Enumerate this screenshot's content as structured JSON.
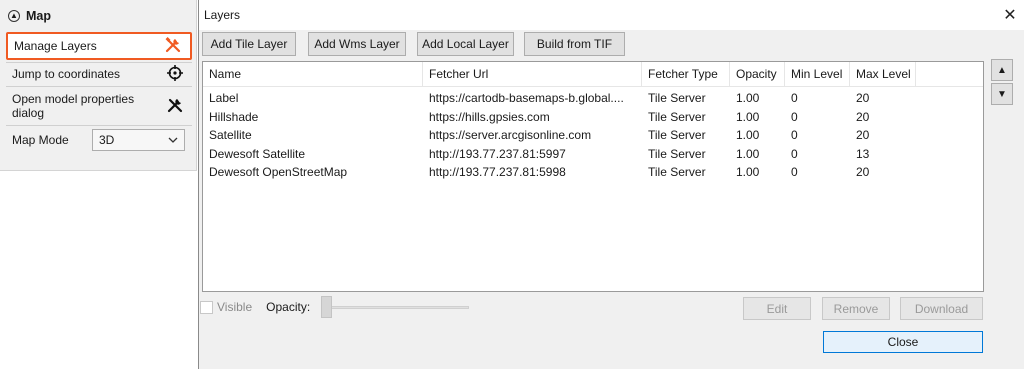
{
  "side": {
    "title": "Map",
    "items": [
      {
        "label": "Manage Layers",
        "icon": "tools-icon"
      },
      {
        "label": "Jump to coordinates",
        "icon": "crosshair-icon"
      },
      {
        "label": "Open model properties dialog",
        "icon": "tools-icon"
      }
    ],
    "map_mode_label": "Map Mode",
    "map_mode_value": "3D",
    "accent": "#f05a22"
  },
  "dialog": {
    "title": "Layers",
    "toolbar": [
      "Add Tile Layer",
      "Add Wms Layer",
      "Add Local Layer",
      "Build from TIF"
    ],
    "columns": [
      "Name",
      "Fetcher Url",
      "Fetcher Type",
      "Opacity",
      "Min Level",
      "Max Level"
    ],
    "rows": [
      [
        "Label",
        "https://cartodb-basemaps-b.global....",
        "Tile Server",
        "1.00",
        "0",
        "20"
      ],
      [
        "Hillshade",
        "https://hills.gpsies.com",
        "Tile Server",
        "1.00",
        "0",
        "20"
      ],
      [
        "Satellite",
        "https://server.arcgisonline.com",
        "Tile Server",
        "1.00",
        "0",
        "20"
      ],
      [
        "Dewesoft Satellite",
        "http://193.77.237.81:5997",
        "Tile Server",
        "1.00",
        "0",
        "13"
      ],
      [
        "Dewesoft OpenStreetMap",
        "http://193.77.237.81:5998",
        "Tile Server",
        "1.00",
        "0",
        "20"
      ]
    ],
    "visible_label": "Visible",
    "opacity_label": "Opacity:",
    "edit_label": "Edit",
    "remove_label": "Remove",
    "download_label": "Download",
    "close_label": "Close"
  }
}
